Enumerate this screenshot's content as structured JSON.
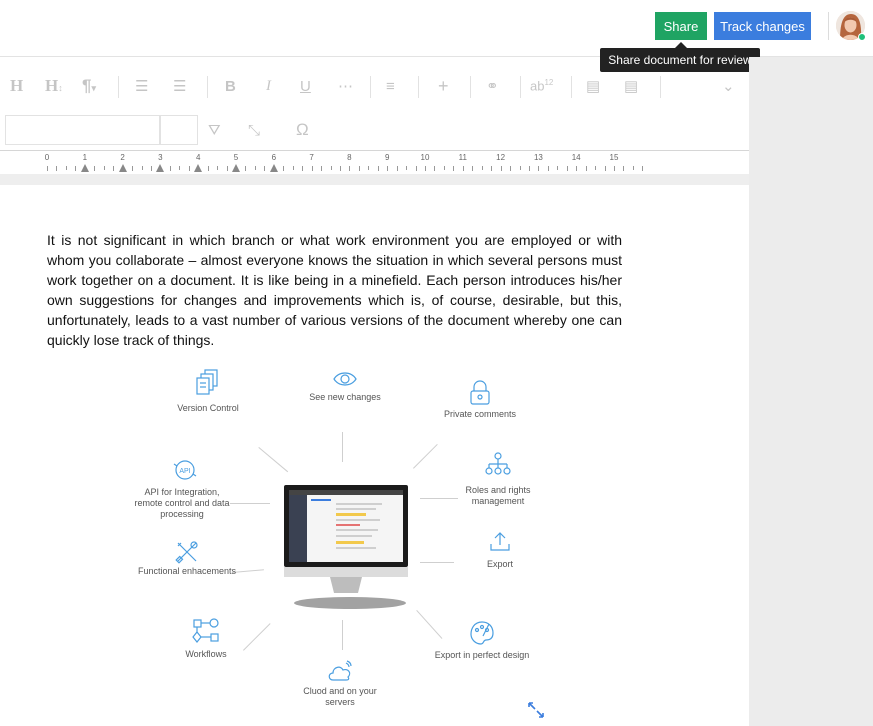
{
  "topbar": {
    "share_label": "Share",
    "track_changes_label": "Track changes",
    "tooltip": "Share document for review",
    "colors": {
      "share": "#1fa463",
      "track": "#3b7dde",
      "online": "#1fc07a"
    }
  },
  "toolbar": {
    "icons": [
      "heading-icon",
      "heading-size-icon",
      "paragraph-icon",
      "bullet-list-icon",
      "numbered-list-icon",
      "bold-icon",
      "italic-icon",
      "underline-icon",
      "strikethrough-icon",
      "align-icon",
      "add-icon",
      "link-icon",
      "superscript-icon",
      "table-icon",
      "table-options-icon",
      "chevron-down-icon",
      "filter-icon",
      "clear-format-icon",
      "omega-icon"
    ]
  },
  "ruler": {
    "numbers": [
      "0",
      "1",
      "2",
      "3",
      "4",
      "5",
      "6",
      "7",
      "8",
      "9",
      "10",
      "11",
      "12",
      "13",
      "14",
      "15"
    ]
  },
  "document": {
    "paragraph": "It is not significant in which branch or what work environment you are employed or with whom you collaborate – almost everyone knows the situation in which several persons must work together on a document. It is like being in a minefield. Each person introduces his/her own suggestions for changes and improvements which is, of course, desirable, but this, unfortunately, leads to a vast number of various versions of the document whereby one can quickly lose track of things."
  },
  "diagram": {
    "labels": {
      "version_control": "Version Control",
      "see_new_changes": "See new changes",
      "private_comments": "Private comments",
      "api_line1": "API for Integration,",
      "api_line2": "remote control and data",
      "api_line3": "processing",
      "roles_line1": "Roles and rights",
      "roles_line2": "management",
      "functional": "Functional enhacements",
      "export": "Export",
      "workflows": "Workflows",
      "export_design": "Export in perfect design",
      "cloud_line1": "Cluod and on your",
      "cloud_line2": "servers"
    },
    "icon_color": "#4a9ee0"
  }
}
